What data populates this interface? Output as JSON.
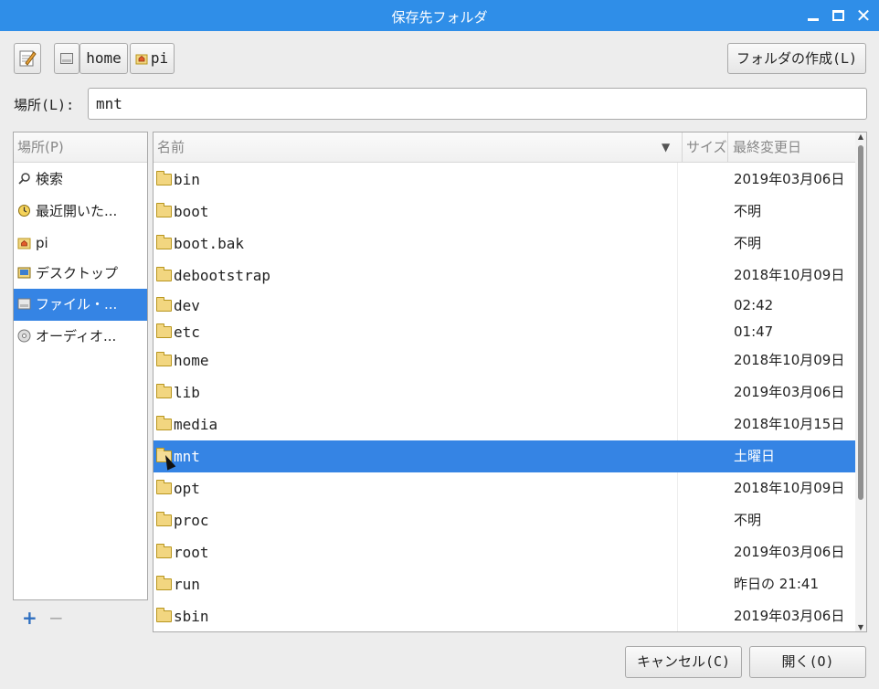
{
  "window": {
    "title": "保存先フォルダ"
  },
  "toolbar": {
    "edit_icon": "pencil-edit-icon",
    "breadcrumbs": [
      {
        "label": "",
        "icon": "disk-icon"
      },
      {
        "label": "home"
      },
      {
        "label": "pi",
        "icon": "home-icon"
      }
    ],
    "create_folder_label": "フォルダの作成(L)"
  },
  "location": {
    "label": "場所(L):",
    "value": "mnt"
  },
  "places": {
    "header": "場所(P)",
    "items": [
      {
        "label": "検索",
        "icon": "search-icon"
      },
      {
        "label": "最近開いた...",
        "icon": "recent-icon"
      },
      {
        "label": "pi",
        "icon": "home-icon"
      },
      {
        "label": "デスクトップ",
        "icon": "desktop-icon"
      },
      {
        "label": "ファイル・...",
        "icon": "filesystem-icon",
        "selected": true
      },
      {
        "label": "オーディオ...",
        "icon": "cd-icon"
      }
    ],
    "add": "+",
    "remove": "−"
  },
  "files": {
    "columns": {
      "name": "名前",
      "size": "サイズ",
      "modified": "最終変更日"
    },
    "rows": [
      {
        "name": "bin",
        "modified": "2019年03月06日"
      },
      {
        "name": "boot",
        "modified": "不明"
      },
      {
        "name": "boot.bak",
        "modified": "不明"
      },
      {
        "name": "debootstrap",
        "modified": "2018年10月09日"
      },
      {
        "name": "dev",
        "modified": "02:42"
      },
      {
        "name": "etc",
        "modified": "01:47"
      },
      {
        "name": "home",
        "modified": "2018年10月09日"
      },
      {
        "name": "lib",
        "modified": "2019年03月06日"
      },
      {
        "name": "media",
        "modified": "2018年10月15日"
      },
      {
        "name": "mnt",
        "modified": "土曜日",
        "selected": true
      },
      {
        "name": "opt",
        "modified": "2018年10月09日"
      },
      {
        "name": "proc",
        "modified": "不明"
      },
      {
        "name": "root",
        "modified": "2019年03月06日"
      },
      {
        "name": "run",
        "modified": "昨日の 21:41"
      },
      {
        "name": "sbin",
        "modified": "2019年03月06日"
      }
    ]
  },
  "buttons": {
    "cancel": "キャンセル(C)",
    "open": "開く(O)"
  }
}
